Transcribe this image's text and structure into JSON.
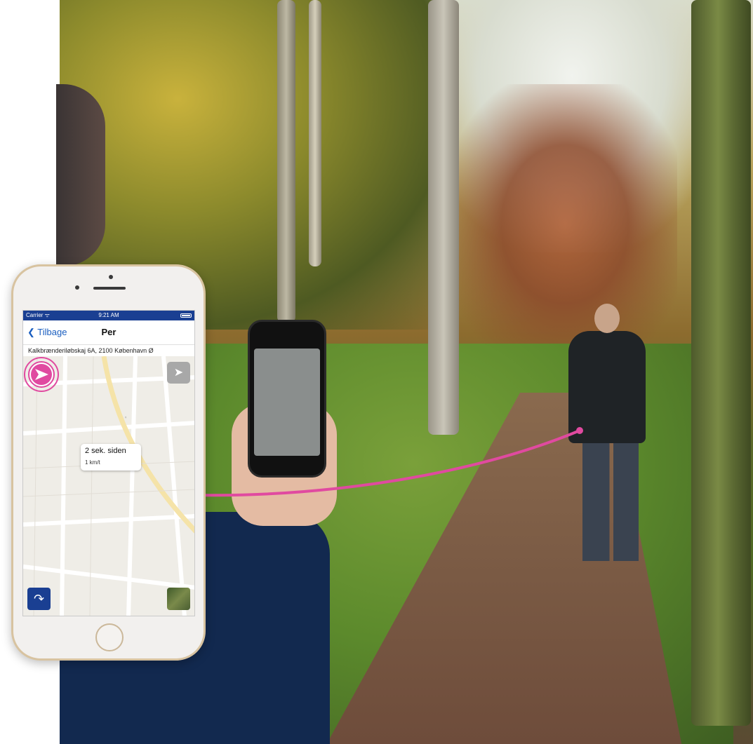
{
  "phone_app": {
    "status_bar": {
      "carrier": "Carrier ᯤ",
      "time": "9:21 AM"
    },
    "nav": {
      "back_label": "Tilbage",
      "title": "Per"
    },
    "address": "Kalkbrænderiløbskaj 6A, 2100 København Ø",
    "location_popup": {
      "time_ago": "2 sek. siden",
      "speed": "1 km/t"
    },
    "icons": {
      "locate": "location-arrow-icon",
      "directions": "turn-right-icon",
      "map_type": "satellite-thumbnail-icon",
      "position": "heading-arrow-icon"
    },
    "accent_color": "#1a3f92",
    "marker_color": "#e04aa0"
  },
  "photo": {
    "description_colors": {
      "track_line": "#e04aa0"
    }
  }
}
